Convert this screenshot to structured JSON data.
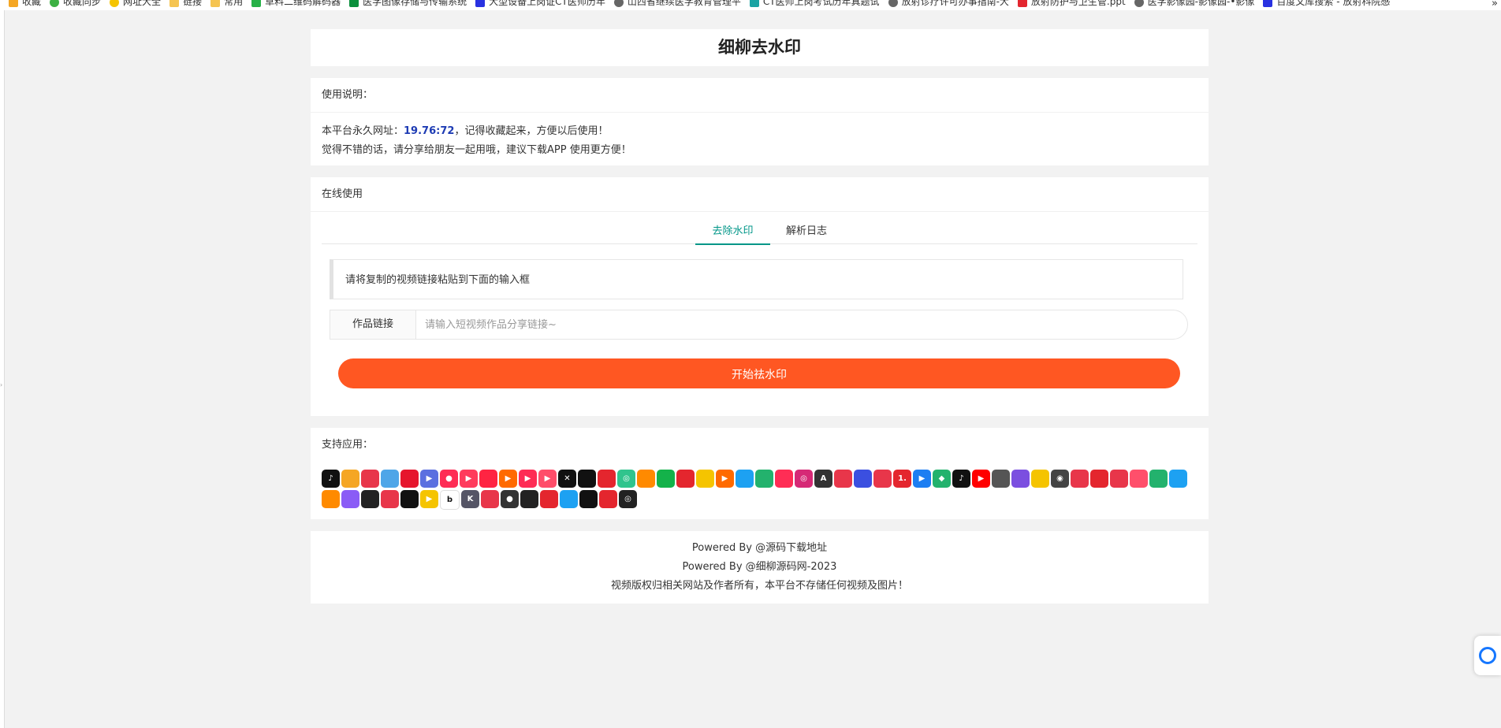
{
  "bookmarks": [
    {
      "label": "收藏",
      "icon": "star-icon",
      "color": "#f5a623"
    },
    {
      "label": "收藏同步",
      "icon": "sync-icon",
      "color": "#3cb043"
    },
    {
      "label": "网址大全",
      "icon": "globe-icon",
      "color": "#f5c400"
    },
    {
      "label": "链接",
      "icon": "folder-icon",
      "color": "#f5c451"
    },
    {
      "label": "常用",
      "icon": "folder-icon",
      "color": "#f5c451"
    },
    {
      "label": "草料二维码解码器",
      "icon": "qrcode-icon",
      "color": "#27b148"
    },
    {
      "label": "医学图像存储与传输系统 ",
      "icon": "linkedin-icon",
      "color": "#0b8f3c"
    },
    {
      "label": "大型设备上岗证CT医师历年",
      "icon": "paw-icon",
      "color": "#2932e1"
    },
    {
      "label": "山西省继续医学教育管理平",
      "icon": "globe-icon",
      "color": "#666666"
    },
    {
      "label": "CT医师上岗考试历年真题试",
      "icon": "doc-icon",
      "color": "#1aa3a3"
    },
    {
      "label": "放射诊疗许可办事指南-大",
      "icon": "globe-icon",
      "color": "#666666"
    },
    {
      "label": "放射防护与卫生管.ppt",
      "icon": "pdf-icon",
      "color": "#e3262f"
    },
    {
      "label": "医学影像园-影像园-•影像",
      "icon": "globe-icon",
      "color": "#666666"
    },
    {
      "label": "百度文库搜索 - 放射科院感",
      "icon": "paw-icon",
      "color": "#2932e1"
    }
  ],
  "bookmarks_close": "»",
  "site_title": "细柳去水印",
  "instructions": {
    "heading": "使用说明：",
    "line1_prefix": "本平台永久网址：",
    "line1_url": "19.76:72",
    "line1_suffix": "，记得收藏起来，方便以后使用！",
    "line2": "觉得不错的话，请分享给朋友一起用哦，建议下载APP 使用更方便！"
  },
  "online": {
    "heading": "在线使用",
    "tabs": [
      {
        "label": "去除水印",
        "active": true
      },
      {
        "label": "解析日志",
        "active": false
      }
    ],
    "notice": "请将复制的视频链接粘贴到下面的输入框",
    "input_label": "作品链接",
    "input_value": "",
    "input_placeholder": "请输入短视频作品分享链接~",
    "submit_label": "开始祛水印",
    "accent": "#009688",
    "button_color": "#ff5722"
  },
  "apps": {
    "heading": "支持应用：",
    "icons": [
      {
        "name": "douyin-icon",
        "color": "#111111",
        "glyph": "♪"
      },
      {
        "name": "app-icon-2",
        "color": "#f5a623",
        "glyph": ""
      },
      {
        "name": "app-icon-3",
        "color": "#e8364a",
        "glyph": ""
      },
      {
        "name": "app-icon-4",
        "color": "#4ea6e8",
        "glyph": ""
      },
      {
        "name": "weibo-icon",
        "color": "#e6162d",
        "glyph": ""
      },
      {
        "name": "app-icon-6",
        "color": "#5b6fe0",
        "glyph": "▶"
      },
      {
        "name": "app-icon-7",
        "color": "#fe2c55",
        "glyph": "●"
      },
      {
        "name": "app-icon-8",
        "color": "#ff3b5c",
        "glyph": "▶"
      },
      {
        "name": "app-icon-9",
        "color": "#ff2442",
        "glyph": ""
      },
      {
        "name": "app-icon-10",
        "color": "#ff6a00",
        "glyph": "▶"
      },
      {
        "name": "app-icon-11",
        "color": "#fe2c55",
        "glyph": "▶"
      },
      {
        "name": "app-icon-12",
        "color": "#ff4d6a",
        "glyph": "▶"
      },
      {
        "name": "capcut-icon",
        "color": "#111111",
        "glyph": "✕"
      },
      {
        "name": "app-icon-14",
        "color": "#111111",
        "glyph": ""
      },
      {
        "name": "toutiao-icon",
        "color": "#e4262e",
        "glyph": ""
      },
      {
        "name": "app-icon-16",
        "color": "#30c48d",
        "glyph": "◎"
      },
      {
        "name": "kuaishou-icon",
        "color": "#ff8a00",
        "glyph": ""
      },
      {
        "name": "app-icon-18",
        "color": "#14b24a",
        "glyph": ""
      },
      {
        "name": "app-icon-19",
        "color": "#e4262e",
        "glyph": ""
      },
      {
        "name": "app-icon-20",
        "color": "#f5c400",
        "glyph": ""
      },
      {
        "name": "app-icon-21",
        "color": "#ff6a00",
        "glyph": "▶"
      },
      {
        "name": "twitter-icon",
        "color": "#1da1f2",
        "glyph": ""
      },
      {
        "name": "app-icon-23",
        "color": "#23b26d",
        "glyph": ""
      },
      {
        "name": "app-icon-24",
        "color": "#ff2d55",
        "glyph": ""
      },
      {
        "name": "instagram-icon",
        "color": "#d62976",
        "glyph": "◎"
      },
      {
        "name": "app-icon-26",
        "color": "#333333",
        "glyph": "A"
      },
      {
        "name": "app-icon-27",
        "color": "#e8364a",
        "glyph": ""
      },
      {
        "name": "app-icon-28",
        "color": "#3b4fe0",
        "glyph": ""
      },
      {
        "name": "app-icon-29",
        "color": "#e8364a",
        "glyph": ""
      },
      {
        "name": "app-icon-30",
        "color": "#e4262e",
        "glyph": "1."
      },
      {
        "name": "app-icon-31",
        "color": "#1c7ef2",
        "glyph": "▶"
      },
      {
        "name": "app-icon-32",
        "color": "#23b26d",
        "glyph": "◆"
      },
      {
        "name": "tiktok-icon",
        "color": "#111111",
        "glyph": "♪"
      },
      {
        "name": "youtube-icon",
        "color": "#ff0000",
        "glyph": "▶"
      },
      {
        "name": "app-icon-35",
        "color": "#555555",
        "glyph": ""
      },
      {
        "name": "app-icon-36",
        "color": "#7b4fe0",
        "glyph": ""
      },
      {
        "name": "app-icon-37",
        "color": "#f5c400",
        "glyph": ""
      },
      {
        "name": "app-icon-38",
        "color": "#444444",
        "glyph": "◉"
      },
      {
        "name": "app-icon-39",
        "color": "#e8364a",
        "glyph": ""
      },
      {
        "name": "netease-icon",
        "color": "#e4262e",
        "glyph": ""
      },
      {
        "name": "app-icon-41",
        "color": "#e8364a",
        "glyph": ""
      },
      {
        "name": "app-icon-42",
        "color": "#ff4f6b",
        "glyph": ""
      },
      {
        "name": "app-icon-43",
        "color": "#23b26d",
        "glyph": ""
      },
      {
        "name": "app-icon-44",
        "color": "#1da1f2",
        "glyph": ""
      },
      {
        "name": "app-icon-45",
        "color": "#ff8a00",
        "glyph": ""
      },
      {
        "name": "app-icon-46",
        "color": "#8a5cf6",
        "glyph": ""
      },
      {
        "name": "app-icon-47",
        "color": "#222222",
        "glyph": ""
      },
      {
        "name": "app-icon-48",
        "color": "#e8364a",
        "glyph": ""
      },
      {
        "name": "app-icon-49",
        "color": "#111111",
        "glyph": ""
      },
      {
        "name": "app-icon-50",
        "color": "#f5c400",
        "glyph": "▶"
      },
      {
        "name": "app-icon-51",
        "color": "#ffffff",
        "glyph": "b"
      },
      {
        "name": "app-icon-52",
        "color": "#555566",
        "glyph": "K"
      },
      {
        "name": "app-icon-53",
        "color": "#e8364a",
        "glyph": ""
      },
      {
        "name": "app-icon-54",
        "color": "#333333",
        "glyph": "●"
      },
      {
        "name": "app-icon-55",
        "color": "#222222",
        "glyph": ""
      },
      {
        "name": "app-icon-56",
        "color": "#e4262e",
        "glyph": ""
      },
      {
        "name": "app-icon-57",
        "color": "#1da1f2",
        "glyph": ""
      },
      {
        "name": "app-icon-58",
        "color": "#111111",
        "glyph": ""
      },
      {
        "name": "app-icon-59",
        "color": "#e4262e",
        "glyph": ""
      },
      {
        "name": "app-icon-60",
        "color": "#222222",
        "glyph": "◎"
      }
    ]
  },
  "footer": {
    "line1": "Powered By @源码下载地址",
    "line2": "Powered By @细柳源码网-2023",
    "line3": "视频版权归相关网站及作者所有，本平台不存储任何视频及图片！"
  }
}
